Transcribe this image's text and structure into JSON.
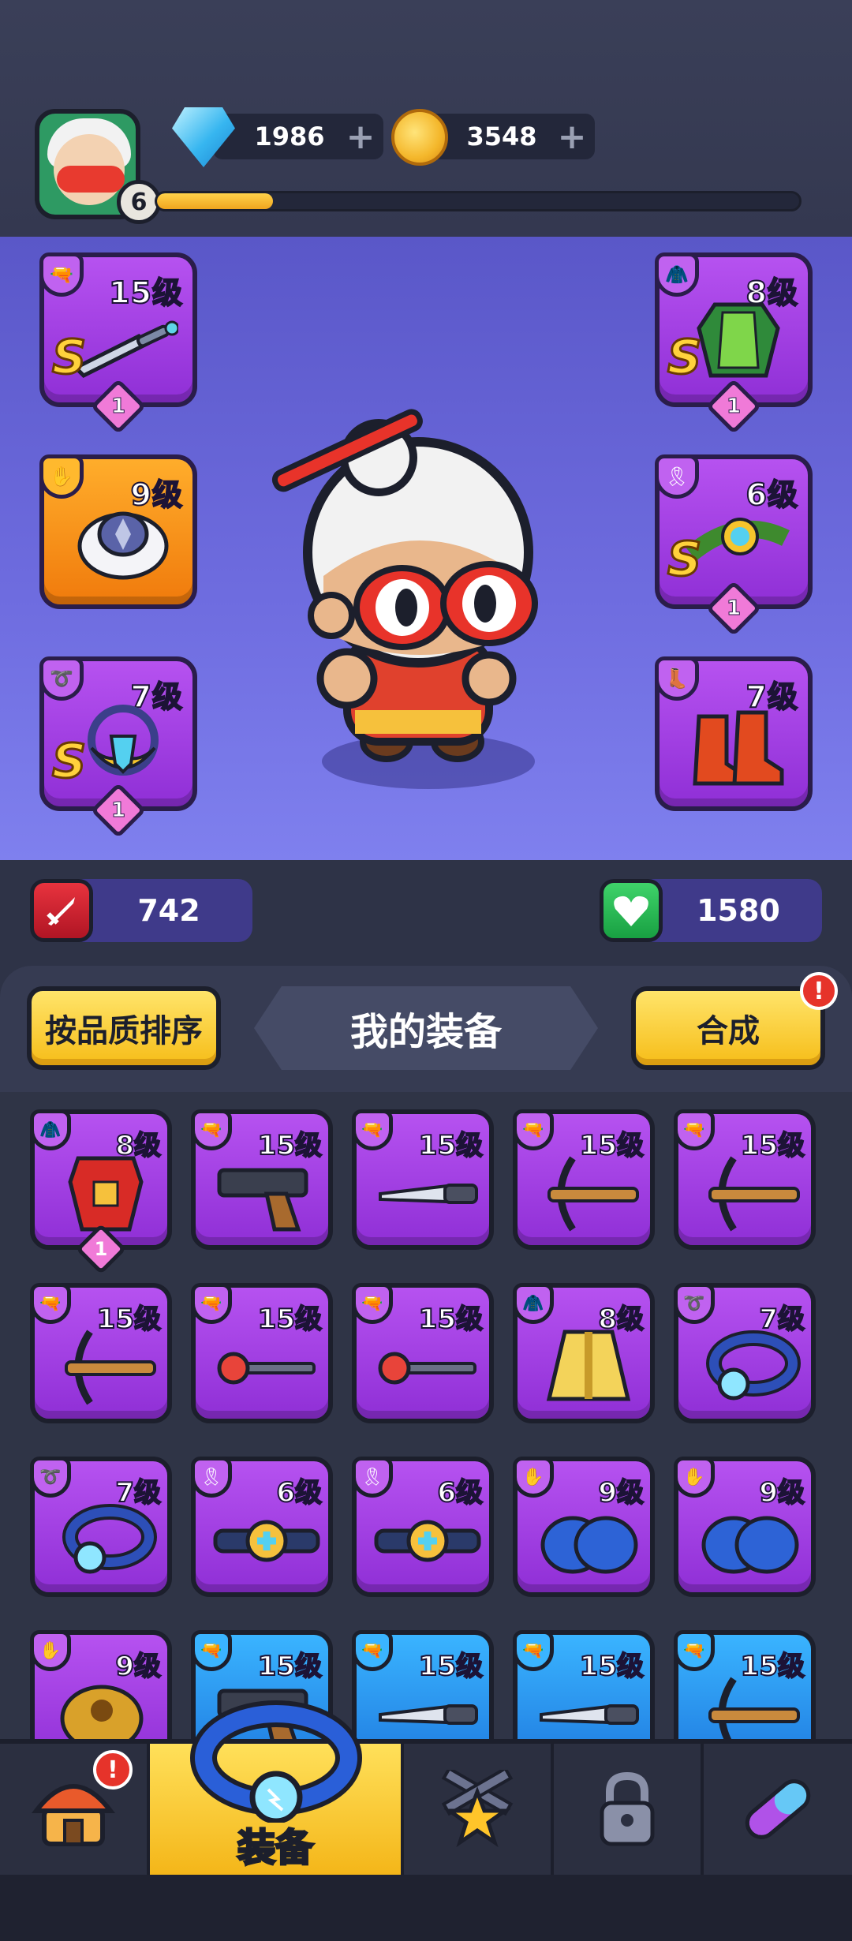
{
  "player": {
    "level": "6",
    "xp_progress": 0.18
  },
  "currencies": {
    "gems": "1986",
    "coins": "3548",
    "plus": "+"
  },
  "equipped": {
    "weapon": {
      "level": "15级",
      "rank": "S",
      "stars": "1"
    },
    "armor": {
      "level": "8级",
      "rank": "S",
      "stars": "1"
    },
    "gloves": {
      "level": "9级"
    },
    "belt": {
      "level": "6级",
      "rank": "S",
      "stars": "1"
    },
    "necklace": {
      "level": "7级",
      "rank": "S",
      "stars": "1"
    },
    "boots": {
      "level": "7级"
    }
  },
  "stats": {
    "attack": "742",
    "hp": "1580"
  },
  "equipment_section": {
    "sort_label": "按品质排序",
    "title": "我的装备",
    "merge_label": "合成",
    "merge_alert": "!"
  },
  "inventory": [
    {
      "level": "8级",
      "type": "armor",
      "rarity": "purple",
      "stars": "1",
      "art": "red-vest-icon"
    },
    {
      "level": "15级",
      "type": "weapon",
      "rarity": "purple",
      "art": "pistol-icon"
    },
    {
      "level": "15级",
      "type": "weapon",
      "rarity": "purple",
      "art": "knife-icon"
    },
    {
      "level": "15级",
      "type": "weapon",
      "rarity": "purple",
      "art": "crossbow-icon"
    },
    {
      "level": "15级",
      "type": "weapon",
      "rarity": "purple",
      "art": "crossbow-icon"
    },
    {
      "level": "15级",
      "type": "weapon",
      "rarity": "purple",
      "art": "crossbow-icon"
    },
    {
      "level": "15级",
      "type": "weapon",
      "rarity": "purple",
      "art": "staff-icon"
    },
    {
      "level": "15级",
      "type": "weapon",
      "rarity": "purple",
      "art": "staff-icon"
    },
    {
      "level": "8级",
      "type": "armor",
      "rarity": "purple",
      "art": "golden-robe-icon"
    },
    {
      "level": "7级",
      "type": "necklace",
      "rarity": "purple",
      "art": "ring-icon"
    },
    {
      "level": "7级",
      "type": "necklace",
      "rarity": "purple",
      "art": "ring-icon"
    },
    {
      "level": "6级",
      "type": "belt",
      "rarity": "purple",
      "art": "belt-icon"
    },
    {
      "level": "6级",
      "type": "belt",
      "rarity": "purple",
      "art": "belt-icon"
    },
    {
      "level": "9级",
      "type": "gloves",
      "rarity": "purple",
      "art": "blue-gloves-icon"
    },
    {
      "level": "9级",
      "type": "gloves",
      "rarity": "purple",
      "art": "blue-gloves-icon"
    },
    {
      "level": "9级",
      "type": "gloves",
      "rarity": "purple",
      "art": "gold-gauntlet-icon"
    },
    {
      "level": "15级",
      "type": "weapon",
      "rarity": "blue",
      "art": "pistol-icon"
    },
    {
      "level": "15级",
      "type": "weapon",
      "rarity": "blue",
      "art": "knife-icon"
    },
    {
      "level": "15级",
      "type": "weapon",
      "rarity": "blue",
      "art": "knife-icon"
    },
    {
      "level": "15级",
      "type": "weapon",
      "rarity": "blue",
      "art": "crossbow-icon"
    }
  ],
  "bottom_nav": {
    "shop_alert": "!",
    "equip_label": "装备",
    "items": [
      "shop-icon",
      "equip-ring-icon",
      "skills-star-icon",
      "lock-icon",
      "potion-icon"
    ]
  },
  "colors": {
    "purple_rarity": "#9a3ae0",
    "blue_rarity": "#2a8ef0",
    "orange_rarity": "#f58a12",
    "accent_yellow": "#f6bd18",
    "alert_red": "#e6332a"
  }
}
